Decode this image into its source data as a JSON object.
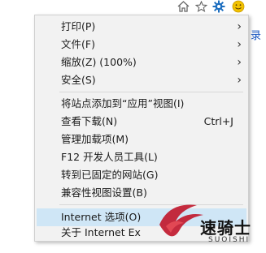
{
  "toolbar": {
    "home_icon": "home-icon",
    "favorites_icon": "star-icon",
    "tools_icon": "gear-icon",
    "feedback_icon": "smiley-icon"
  },
  "side_text": "录",
  "menu": {
    "items": [
      {
        "label": "打印(P)",
        "submenu": true
      },
      {
        "label": "文件(F)",
        "submenu": true
      },
      {
        "label": "缩放(Z) (100%)",
        "submenu": true
      },
      {
        "label": "安全(S)",
        "submenu": true
      },
      {
        "label": "将站点添加到“应用”视图(I)"
      },
      {
        "label": "查看下载(N)",
        "shortcut": "Ctrl+J"
      },
      {
        "label": "管理加载项(M)"
      },
      {
        "label": "F12 开发人员工具(L)"
      },
      {
        "label": "转到已固定的网站(G)"
      },
      {
        "label": "兼容性视图设置(B)"
      },
      {
        "label": "Internet 选项(O)",
        "highlighted": true
      },
      {
        "label": "关于 Internet Ex"
      }
    ],
    "arrow_glyph": "›"
  },
  "watermark": {
    "text": "速骑士",
    "subtext": "SUOISHI"
  },
  "colors": {
    "menu_bg": "#f2f2f2",
    "highlight": "#cfe6f6",
    "gear": "#1e6fc0",
    "smile": "#f2c200",
    "logo_red": "#c0152a"
  }
}
